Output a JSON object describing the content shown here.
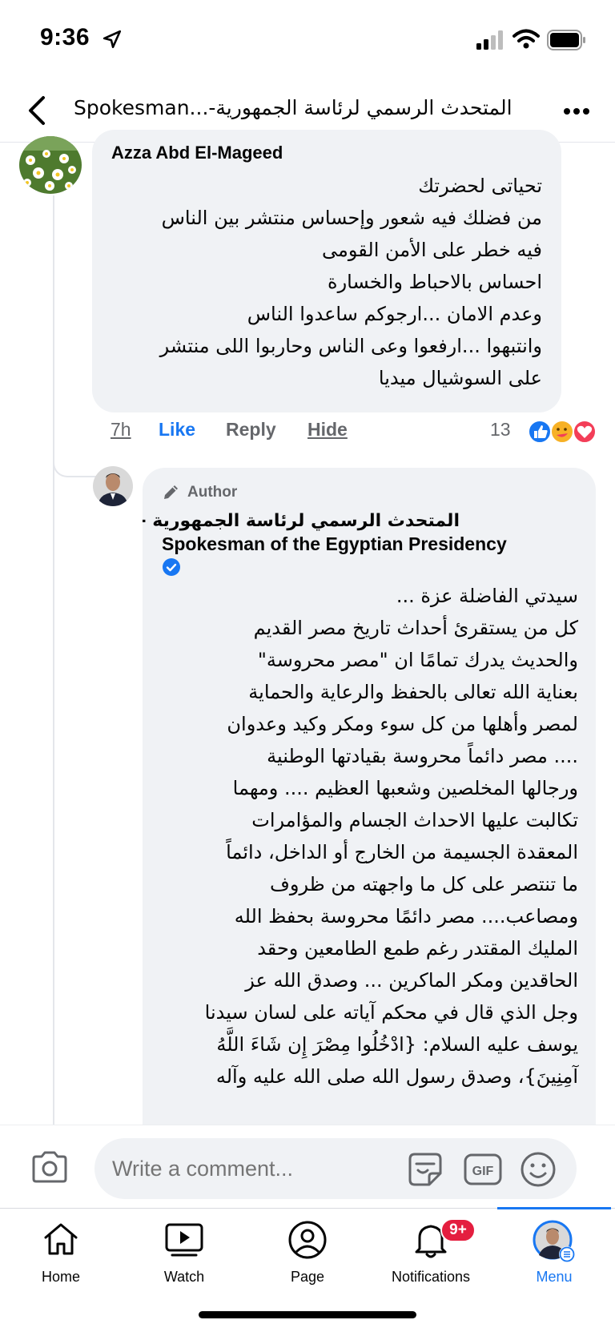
{
  "status_bar": {
    "time": "9:36"
  },
  "header": {
    "title": "المتحدث الرسمي لرئاسة الجمهورية-...Spokesman"
  },
  "comment1": {
    "author": "Azza Abd El-Mageed",
    "text": "تحياتى لحضرتك\nمن فضلك فيه شعور وإحساس منتشر بين الناس\nفيه خطر على الأمن القومى\nاحساس بالاحباط والخسارة\nوعدم الامان ...ارجوكم ساعدوا الناس\nوانتبهوا ...ارفعوا وعى الناس وحاربوا اللى منتشر\nعلى السوشيال ميديا",
    "time": "7h",
    "like": "Like",
    "reply": "Reply",
    "hide": "Hide",
    "reaction_count": "13"
  },
  "reply1": {
    "badge": "Author",
    "author_ar": "المتحدث الرسمي لرئاسة الجمهورية -",
    "author_en": "Spokesman of the Egyptian Presidency",
    "text": "سيدتي الفاضلة عزة ...\nكل من يستقرئ أحداث تاريخ مصر القديم\nوالحديث يدرك تمامًا ان \"مصر محروسة\"\nبعناية الله تعالى بالحفظ والرعاية والحماية\nلمصر وأهلها من كل سوء ومكر وكيد وعدوان\n.... مصر دائماً محروسة بقيادتها الوطنية\nورجالها المخلصين وشعبها العظيم .... ومهما\nتكالبت عليها الاحداث الجسام والمؤامرات\nالمعقدة الجسيمة من الخارج أو الداخل، دائماً\nما تنتصر على كل ما واجهته من ظروف\nومصاعب.... مصر دائمًا محروسة بحفظ الله\nالمليك المقتدر رغم طمع الطامعين وحقد\nالحاقدين ومكر الماكرين ... وصدق الله عز\nوجل الذي قال في محكم آياته على لسان سيدنا\nيوسف عليه السلام: {ادْخُلُوا مِصْرَ إِن شَاءَ اللَّهُ\nآمِنِينَ}، وصدق رسول الله صلى الله عليه وآله"
  },
  "composer": {
    "placeholder": "Write a comment..."
  },
  "nav": {
    "items": [
      {
        "label": "Home",
        "icon": "home-icon"
      },
      {
        "label": "Watch",
        "icon": "watch-icon"
      },
      {
        "label": "Page",
        "icon": "page-icon"
      },
      {
        "label": "Notifications",
        "icon": "bell-icon",
        "badge": "9+"
      },
      {
        "label": "Menu",
        "icon": "menu-avatar-icon",
        "active": true
      }
    ]
  },
  "colors": {
    "accent": "#1877f2",
    "badge": "#e41e3f",
    "muted": "#65676b",
    "bubble": "#f0f2f5"
  }
}
